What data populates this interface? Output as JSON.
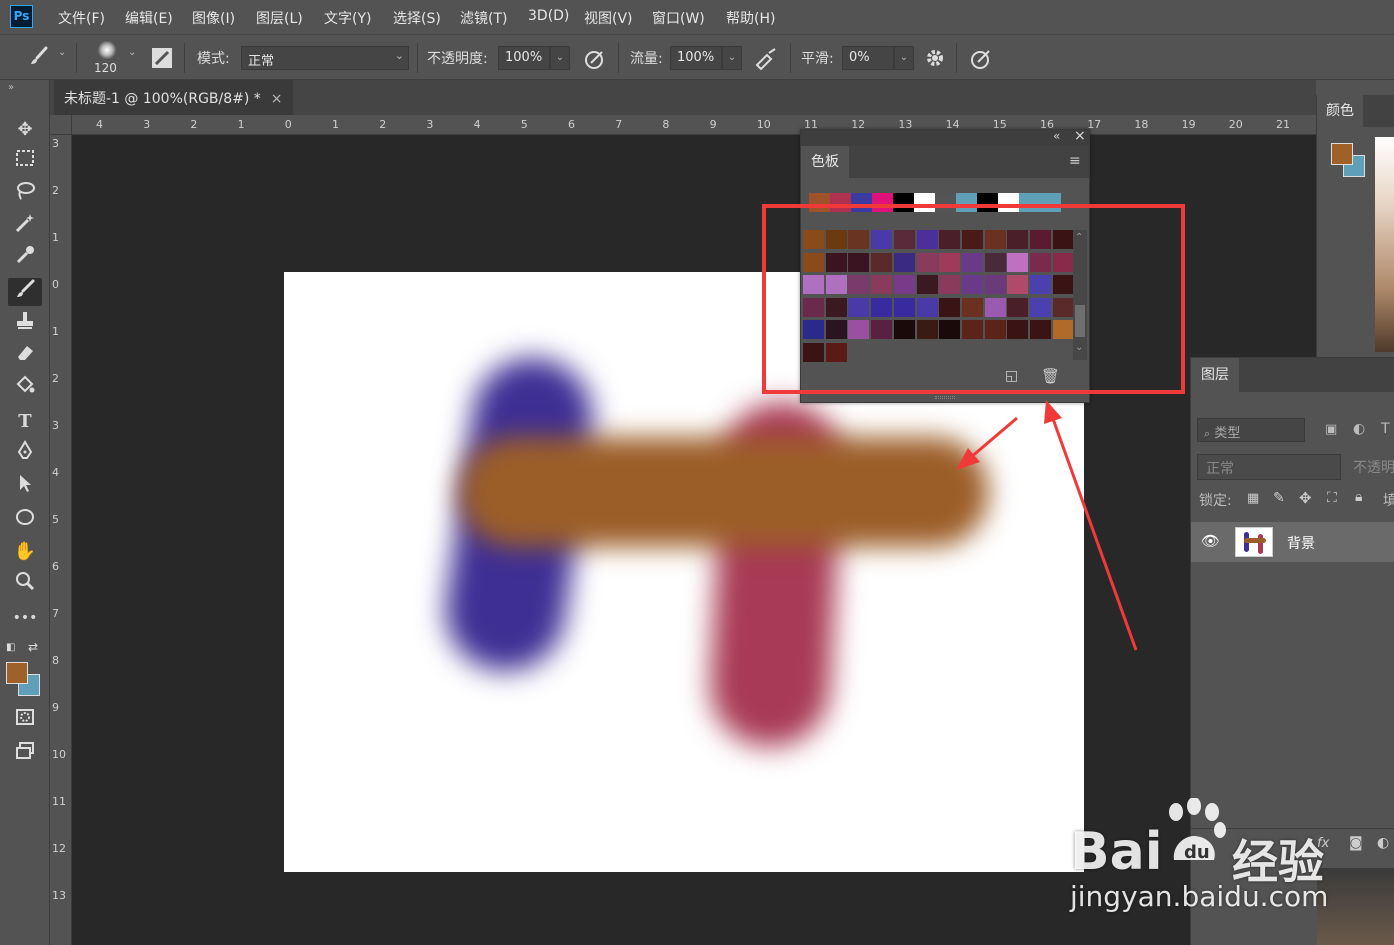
{
  "menu": {
    "logo": "Ps",
    "items": [
      "文件(F)",
      "编辑(E)",
      "图像(I)",
      "图层(L)",
      "文字(Y)",
      "选择(S)",
      "滤镜(T)",
      "3D(D)",
      "视图(V)",
      "窗口(W)",
      "帮助(H)"
    ]
  },
  "options": {
    "brush_size": "120",
    "mode_label": "模式:",
    "mode_value": "正常",
    "opacity_label": "不透明度:",
    "opacity_value": "100%",
    "flow_label": "流量:",
    "flow_value": "100%",
    "smooth_label": "平滑:",
    "smooth_value": "0%"
  },
  "document": {
    "tab_title": "未标题-1 @ 100%(RGB/8#) *",
    "close": "×"
  },
  "rulers": {
    "top": [
      "4",
      "3",
      "2",
      "1",
      "0",
      "1",
      "2",
      "3",
      "4",
      "5",
      "6",
      "7",
      "8",
      "9",
      "10",
      "11",
      "12",
      "13",
      "14",
      "15",
      "16",
      "17",
      "18",
      "19",
      "20",
      "21"
    ],
    "left": [
      "3",
      "2",
      "1",
      "0",
      "1",
      "2",
      "3",
      "4",
      "5",
      "6",
      "7",
      "8",
      "9",
      "10",
      "11",
      "12",
      "13"
    ]
  },
  "swatches_panel": {
    "tab": "色板",
    "collapse": "«",
    "close": "×",
    "recent": [
      "#a0522d",
      "#b03050",
      "#3a3aa0",
      "#e0127a",
      "#000000",
      "#ffffff",
      "#555555",
      "#5fa0b8",
      "#000000",
      "#ffffff",
      "#5fa0b8",
      "#5fa0b8"
    ],
    "grid": [
      [
        "#8a4a1a",
        "#6b3a0f",
        "#6a3422",
        "#4a3aa8",
        "#5a2a3a",
        "#4a3098",
        "#4a1f2a",
        "#4a1a18",
        "#6a3020",
        "#4a1f2a",
        "#5a1a30",
        "#3a1414"
      ],
      [
        "#8a4a1a",
        "#3a1420",
        "#3a1420",
        "#5a2a2a",
        "#3a2a80",
        "#8a3a5a",
        "#a03a5a",
        "#6a3a8a",
        "#4a2a3a",
        "#c070c0",
        "#7a2a4a",
        "#8a2a4a"
      ],
      [
        "#b070c0",
        "#b070c0",
        "#7a3a6a",
        "#8a3a5a",
        "#7a3a8a",
        "#3a1a20",
        "#8a3a5a",
        "#6a3a8a",
        "#6a3a7a",
        "#b04a6a",
        "#4a40b0",
        "#3a1414"
      ],
      [
        "#6a2a4a",
        "#3a1a20",
        "#4a3aa8",
        "#3a2aa0",
        "#3a2aa0",
        "#4a3aa8",
        "#3a1414",
        "#6a3020",
        "#9a5ab0",
        "#4a1f2a",
        "#4a40b0",
        "#5a2a2a"
      ],
      [
        "#2a2a8a",
        "#2a1420",
        "#9a50a0",
        "#5a2040",
        "#1a0a0a",
        "#3a1a14",
        "#1a0a0a",
        "#5a2418",
        "#5a2418",
        "#3a1414",
        "#3a1414",
        "#b06a2a"
      ],
      [
        "#3a1414",
        "#5a1a18"
      ]
    ]
  },
  "color_panel": {
    "tab": "颜色",
    "fg": "#a0602a",
    "bg": "#5fa0b8"
  },
  "layers_panel": {
    "tab": "图层",
    "filter_label": "类型",
    "blend_mode": "正常",
    "opacity_label": "不透明",
    "lock_label": "锁定:",
    "fill_label": "填",
    "layer_name": "背景"
  },
  "watermark": {
    "brand": "Bai",
    "brand2": "经验",
    "url": "jingyan.baidu.com"
  }
}
